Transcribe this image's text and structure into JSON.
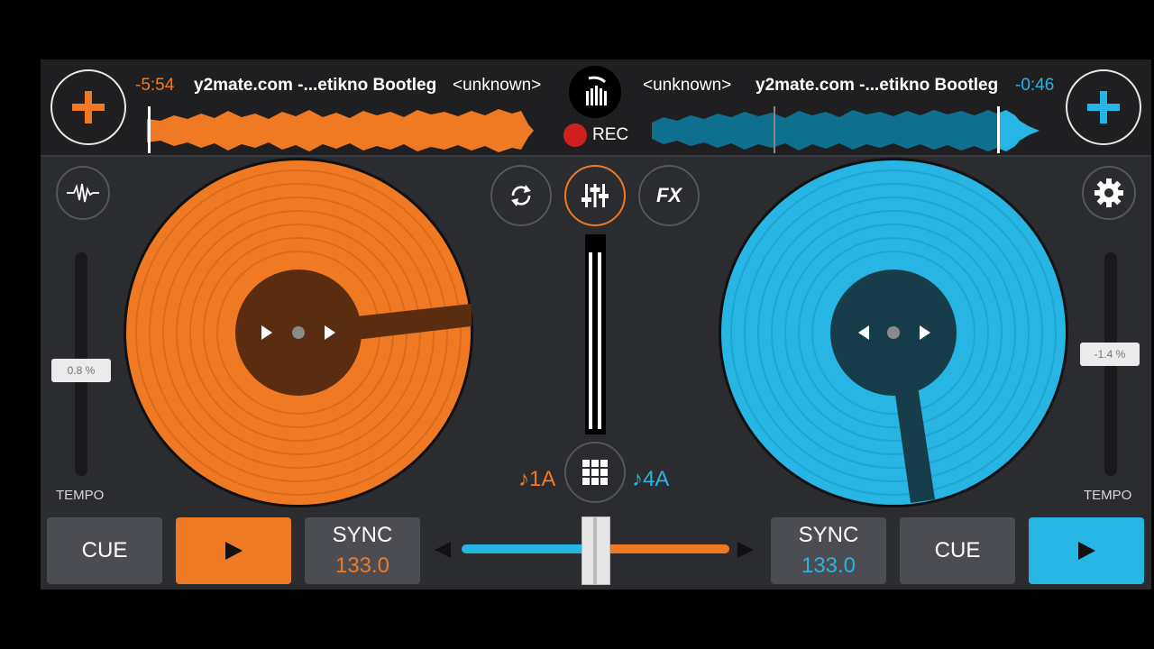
{
  "left_deck": {
    "time": "-5:54",
    "title": "y2mate.com -...etikno Bootleg",
    "artist": "<unknown>",
    "tempo": "0.8 %",
    "tempo_label": "TEMPO",
    "key": "♪1A",
    "cue_label": "CUE",
    "sync_label": "SYNC",
    "bpm": "133.0"
  },
  "right_deck": {
    "time": "-0:46",
    "title": "y2mate.com -...etikno Bootleg",
    "artist": "<unknown>",
    "tempo": "-1.4 %",
    "tempo_label": "TEMPO",
    "key": "♪4A",
    "cue_label": "CUE",
    "sync_label": "SYNC",
    "bpm": "133.0"
  },
  "center": {
    "rec_label": "REC",
    "fx_label": "FX"
  },
  "colors": {
    "left_accent": "#f07a24",
    "right_accent": "#27b5e3",
    "background": "#2b2c30"
  },
  "icons": {
    "add_left": "plus-icon",
    "add_right": "plus-icon",
    "waveform": "waveform-icon",
    "settings": "gear-icon",
    "loop": "loop-icon",
    "mixer": "mixer-sliders-icon",
    "sampler": "grid-icon",
    "play": "play-icon"
  },
  "crossfader": {
    "value": 0.5
  }
}
